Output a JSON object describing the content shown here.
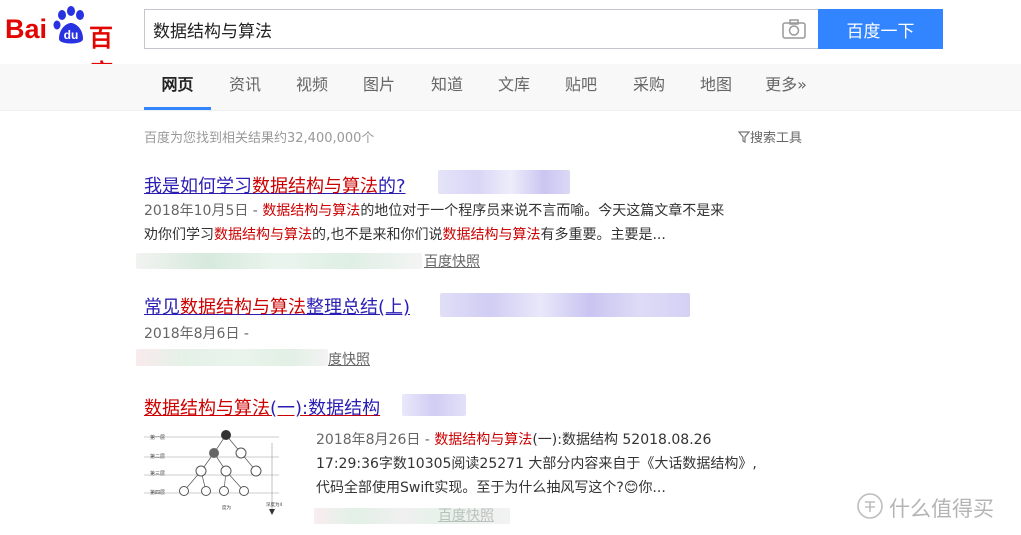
{
  "header": {
    "logo_text_left": "Bai",
    "logo_text_middle": "du",
    "logo_text_right": "百度",
    "search_value": "数据结构与算法",
    "search_button": "百度一下"
  },
  "tabs": [
    "网页",
    "资讯",
    "视频",
    "图片",
    "知道",
    "文库",
    "贴吧",
    "采购",
    "地图",
    "更多»"
  ],
  "toolbar": {
    "result_count": "百度为您找到相关结果约32,400,000个",
    "search_tools": "搜索工具"
  },
  "results": [
    {
      "title_pre": "我是如何学习",
      "title_em": "数据结构与算法",
      "title_post": "的?",
      "date": "2018年10月5日",
      "line1_em": "数据结构与算法",
      "line1_post": "的地位对于一个程序员来说不言而喻。今天这篇文章不是来",
      "line2_pre": "劝你们学习",
      "line2_em1": "数据结构与算法",
      "line2_mid": "的,也不是来和你们说",
      "line2_em2": "数据结构与算法",
      "line2_post": "有多重要。主要是...",
      "cache": "百度快照"
    },
    {
      "title_pre": "常见",
      "title_em": "数据结构与算法",
      "title_post": "整理总结(上)",
      "date": "2018年8月6日 -",
      "cache": "度快照"
    },
    {
      "title_em": "数据结构与算法",
      "title_post": "(一):数据结构",
      "date": "2018年8月26日",
      "line1_em": "数据结构与算法",
      "line1_post": "(一):数据结构 52018.08.26",
      "line2": "17:29:36字数10305阅读25271 大部分内容来自于《大话数据结构》,",
      "line3": "代码全部使用Swift实现。至于为什么抽风写这个?",
      "line3_emoji": "😊",
      "line3_post": "你...",
      "cache": "百度快照"
    }
  ],
  "thumbnail": {
    "level_labels": [
      "第一层",
      "第二层",
      "第三层",
      "第四层"
    ],
    "side_label": "深度为4",
    "bottom_label": "度为"
  },
  "watermark": "值 什么值得买",
  "colors": {
    "brand_red": "#e10602",
    "button_blue": "#3385ff",
    "link_blue": "#2a1db3",
    "highlight_red": "#cc0000"
  }
}
